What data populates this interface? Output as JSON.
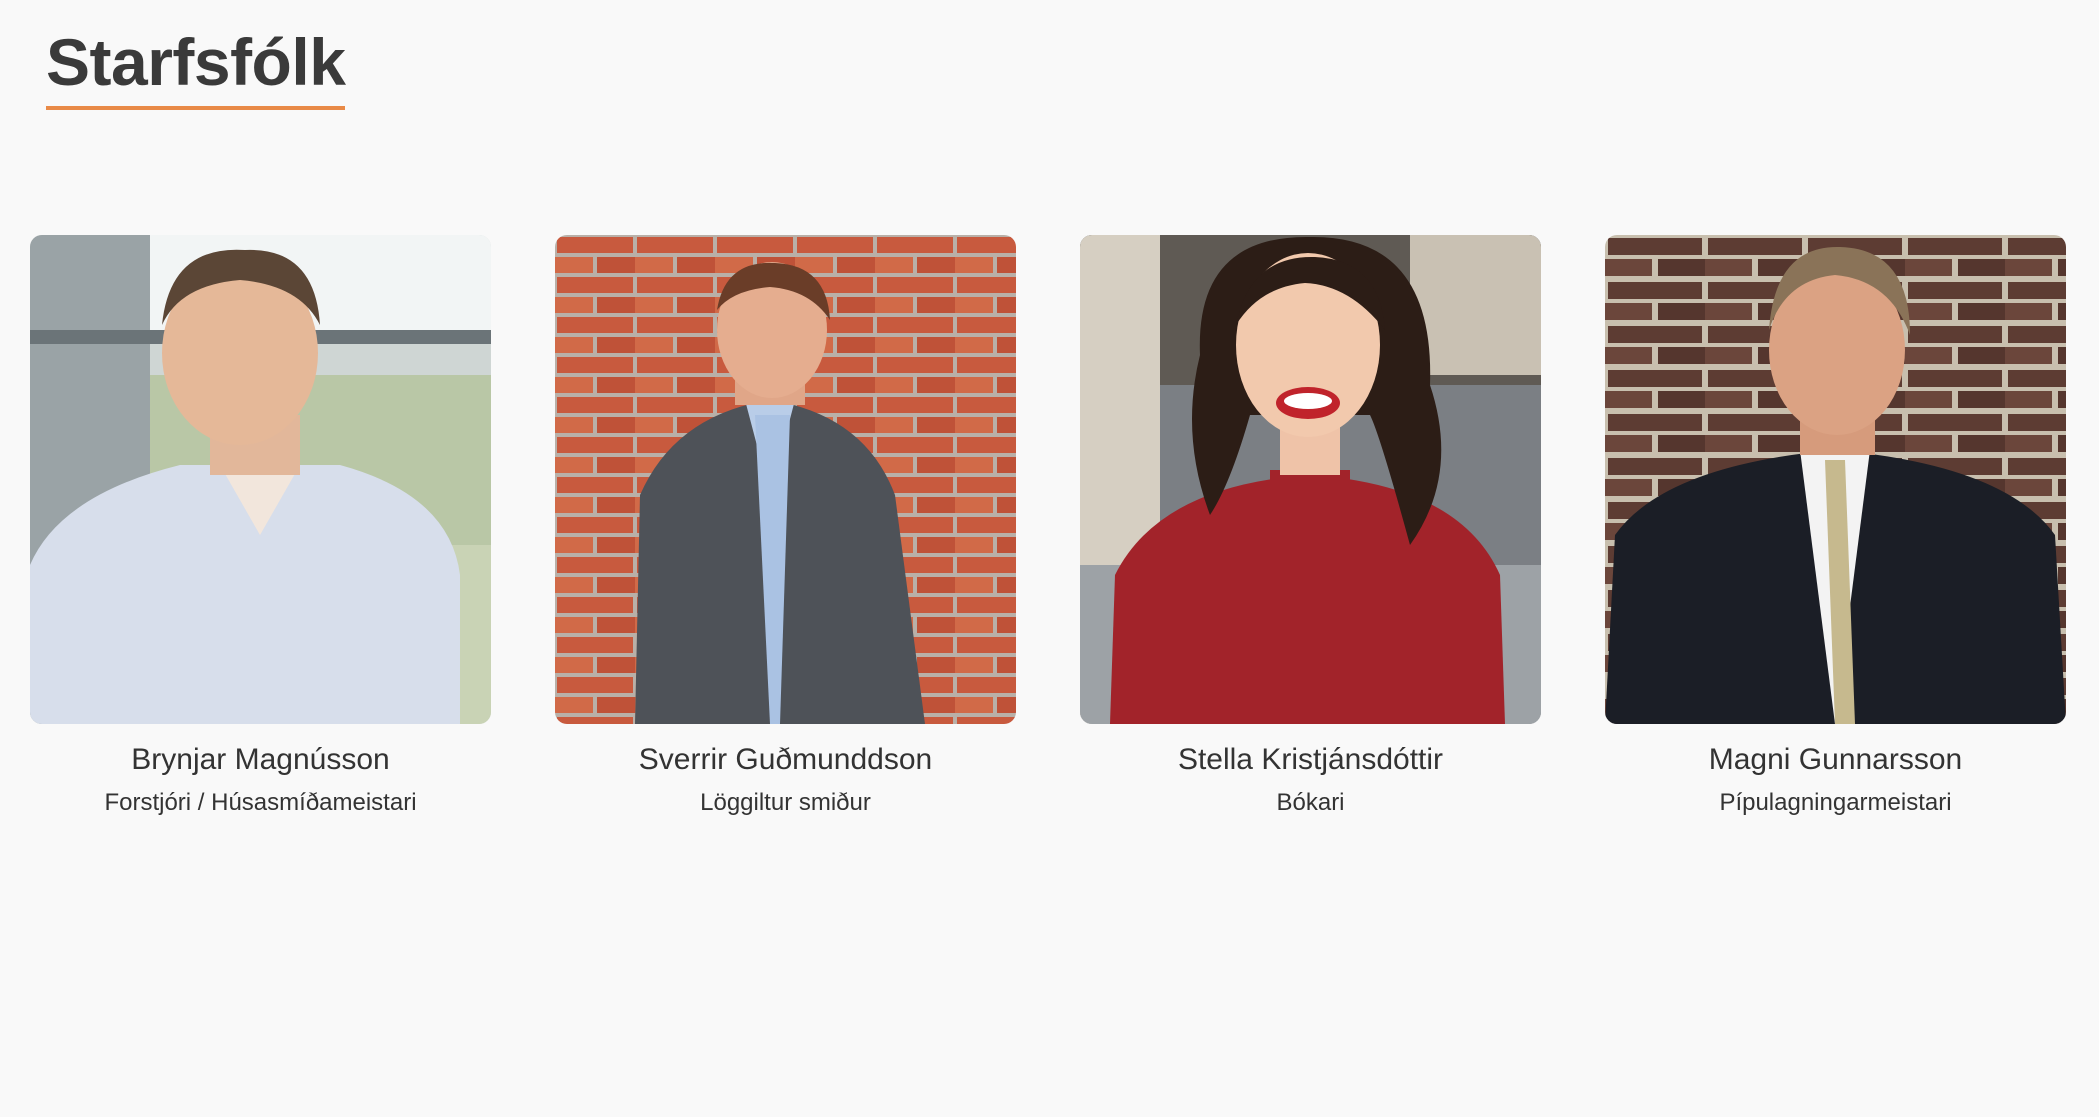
{
  "page": {
    "title": "Starfsfólk"
  },
  "staff": [
    {
      "name": "Brynjar Magnússon",
      "role": "Forstjóri / Húsasmíðameistari",
      "photo_icon": "portrait-photo"
    },
    {
      "name": "Sverrir Guðmunddson",
      "role": "Löggiltur smiður",
      "photo_icon": "portrait-photo"
    },
    {
      "name": "Stella Kristjánsdóttir",
      "role": "Bókari",
      "photo_icon": "portrait-photo"
    },
    {
      "name": "Magni Gunnarsson",
      "role": "Pípulagningarmeistari",
      "photo_icon": "portrait-photo"
    }
  ],
  "colors": {
    "title_underline": "#e98a47",
    "background": "#f9f9f9"
  }
}
